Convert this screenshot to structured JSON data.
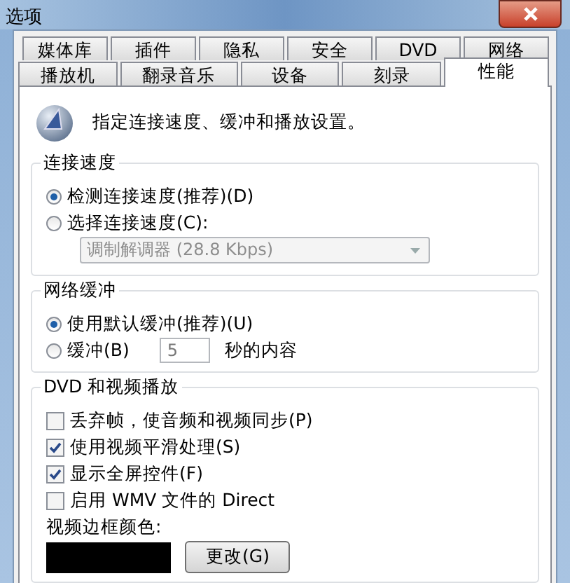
{
  "window": {
    "title": "选项"
  },
  "tab_rows": [
    [
      {
        "label": "媒体库",
        "selected": false
      },
      {
        "label": "插件",
        "selected": false
      },
      {
        "label": "隐私",
        "selected": false
      },
      {
        "label": "安全",
        "selected": false
      },
      {
        "label": "DVD",
        "selected": false
      },
      {
        "label": "网络",
        "selected": false
      }
    ],
    [
      {
        "label": "播放机",
        "selected": false
      },
      {
        "label": "翻录音乐",
        "selected": false
      },
      {
        "label": "设备",
        "selected": false
      },
      {
        "label": "刻录",
        "selected": false
      },
      {
        "label": "性能",
        "selected": true
      }
    ]
  ],
  "header": {
    "text": "指定连接速度、缓冲和播放设置。"
  },
  "groups": [
    {
      "title": "连接速度",
      "items": [
        {
          "kind": "radio",
          "label": "检测连接速度(推荐)(D)",
          "selected": true
        },
        {
          "kind": "radio",
          "label": "选择连接速度(C):",
          "selected": false
        },
        {
          "kind": "dropdown",
          "value": "调制解调器 (28.8 Kbps)",
          "disabled": true
        }
      ]
    },
    {
      "title": "网络缓冲",
      "items": [
        {
          "kind": "radio",
          "label": "使用默认缓冲(推荐)(U)",
          "selected": true
        },
        {
          "kind": "radio_input",
          "label": "缓冲(B)",
          "selected": false,
          "value": "5",
          "suffix": "秒的内容"
        }
      ]
    },
    {
      "title": "DVD 和视频播放",
      "items": [
        {
          "kind": "checkbox",
          "label": "丢弃帧，使音频和视频同步(P)",
          "checked": false
        },
        {
          "kind": "checkbox",
          "label": "使用视频平滑处理(S)",
          "checked": true
        },
        {
          "kind": "checkbox",
          "label": "显示全屏控件(F)",
          "checked": true
        },
        {
          "kind": "checkbox",
          "label": "启用 WMV 文件的 Direct",
          "checked": false
        },
        {
          "kind": "text",
          "label": "视频边框颜色:"
        },
        {
          "kind": "color",
          "color": "#000000",
          "button": "更改(G)"
        }
      ]
    }
  ]
}
